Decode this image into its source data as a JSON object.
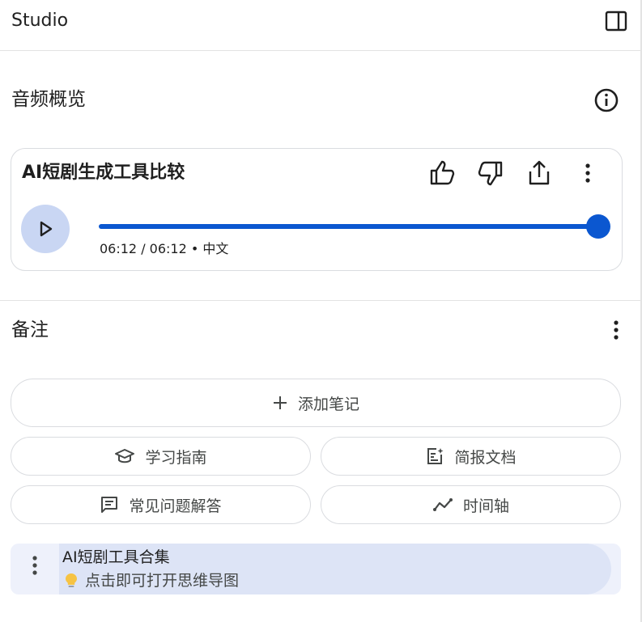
{
  "header": {
    "title": "Studio",
    "panel_icon": "side-panel-icon"
  },
  "audio_overview": {
    "section_title": "音频概览",
    "info_icon": "info-icon",
    "card": {
      "title": "AI短剧生成工具比较",
      "actions": [
        "thumb-up-icon",
        "thumb-down-icon",
        "share-icon",
        "more-vert-icon"
      ],
      "progress": 1.0,
      "time_text": "06:12 / 06:12 • 中文",
      "accent_color": "#0b57d0",
      "play_bg": "#c9d6f3"
    }
  },
  "notes": {
    "section_title": "备注",
    "add_note_label": "添加笔记",
    "buttons": {
      "study_guide": "学习指南",
      "briefing_doc": "简报文档",
      "faq": "常见问题解答",
      "timeline": "时间轴"
    },
    "items": [
      {
        "title": "AI短剧工具合集",
        "subtitle": "点击即可打开思维导图",
        "icon": "lightbulb-icon"
      }
    ]
  }
}
